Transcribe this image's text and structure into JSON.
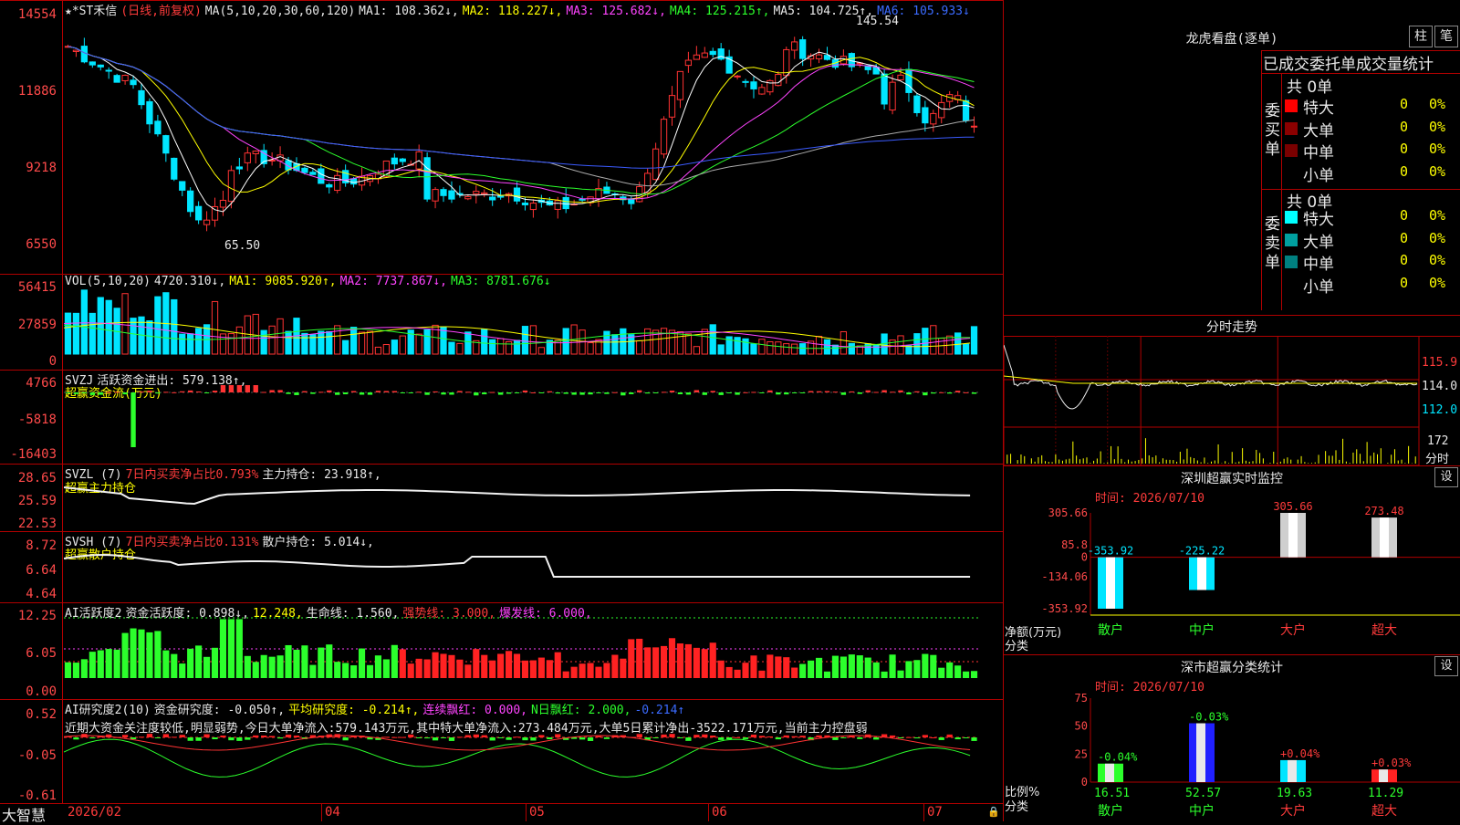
{
  "main": {
    "title": "★*ST禾信",
    "period": "(日线,前复权)",
    "ma_label": "MA(5,10,20,30,60,120)",
    "ma1": "MA1: 108.362↓,",
    "ma2": "MA2: 118.227↓,",
    "ma3": "MA3: 125.682↓,",
    "ma4": "MA4: 125.215↑,",
    "ma5": "MA5: 104.725↑,",
    "ma6": "MA6: 105.933↓",
    "y_ticks": [
      "14554",
      "11886",
      "9218",
      "6550"
    ],
    "high_label": "145.54",
    "low_label": "65.50",
    "price_axis": {
      "max": 14554,
      "min": 6550
    }
  },
  "vol": {
    "title": "VOL(5,10,20)",
    "value": "4720.310↓,",
    "ma1": "MA1: 9085.920↑,",
    "ma2": "MA2: 7737.867↓,",
    "ma3": "MA3: 8781.676↓",
    "y_ticks": [
      "56415",
      "27859",
      "0"
    ]
  },
  "svzj": {
    "title": "SVZJ",
    "label": "活跃资金进出: 579.138↑,",
    "sub": "超赢资金流(万元)",
    "y_ticks": [
      "4766",
      "-5818",
      "-16403"
    ]
  },
  "svzl": {
    "title": "SVZL (7)",
    "label": "7日内买卖净占比0.793%",
    "label2": "主力持仓: 23.918↑,",
    "sub": "超赢主力持仓",
    "y_ticks": [
      "28.65",
      "25.59",
      "22.53"
    ]
  },
  "svsh": {
    "title": "SVSH (7)",
    "label": "7日内买卖净占比0.131%",
    "label2": "散户持仓: 5.014↓,",
    "sub": "超赢散户持仓",
    "y_ticks": [
      "8.72",
      "6.64",
      "4.64"
    ]
  },
  "ai1": {
    "title": "AI活跃度2",
    "a": "资金活跃度: 0.898↓,",
    "b": "12.248,",
    "c": "生命线: 1.560,",
    "d": "强势线: 3.000,",
    "e": "爆发线: 6.000,",
    "y_ticks": [
      "12.25",
      "6.05",
      "0.00"
    ]
  },
  "ai2": {
    "title": "AI研究度2(10)",
    "a": "资金研究度: -0.050↑,",
    "b": "平均研究度: -0.214↑,",
    "c": "连续飘红: 0.000,",
    "d": "N日飘红: 2.000,",
    "e": "-0.214↑",
    "note": "近期大资金关注度较低,明显弱势,今日大单净流入:579.143万元,其中特大单净流入:273.484万元,大单5日累计净出-3522.171万元,当前主力控盘弱",
    "y_ticks": [
      "0.52",
      "-0.05",
      "-0.61"
    ]
  },
  "date_axis": {
    "brand": "大智慧",
    "labels": [
      "2026/02",
      "04",
      "05",
      "06",
      "07"
    ]
  },
  "lhb": {
    "title": "龙虎看盘(逐单)",
    "btn_bar": "柱",
    "btn_pen": "笔",
    "heading": "已成交委托单成交量统计",
    "buy_group": "委买单",
    "sell_group": "委卖单",
    "buy_total": "共 0单",
    "sell_total": "共 0单",
    "rows": [
      {
        "name": "特大",
        "count": "0",
        "pct": "0%"
      },
      {
        "name": "大单",
        "count": "0",
        "pct": "0%"
      },
      {
        "name": "中单",
        "count": "0",
        "pct": "0%"
      },
      {
        "name": "小单",
        "count": "0",
        "pct": "0%"
      }
    ],
    "buy_colors": [
      "#ff0000",
      "#8b0000",
      "#7a0000",
      "#000000"
    ],
    "sell_colors": [
      "#00ffff",
      "#00a0a0",
      "#008080",
      "#000000"
    ]
  },
  "intraday": {
    "title": "分时走势",
    "y_ticks": [
      "115.9",
      "114.0",
      "112.0"
    ],
    "vol_label": "172",
    "vol_unit": "分时"
  },
  "monitor": {
    "title": "深圳超赢实时监控",
    "btn": "设",
    "time": "时间: 2026/07/10",
    "y_ticks": [
      "305.66",
      "85.8",
      "0",
      "-134.06",
      "-353.92"
    ],
    "y_title": "净额(万元)",
    "x_title": "分类",
    "categories": [
      "散户",
      "中户",
      "大户",
      "超大"
    ],
    "values": [
      -353.92,
      -225.22,
      305.66,
      273.48
    ],
    "value_labels": [
      "-353.92",
      "-225.22",
      "305.66",
      "273.48"
    ]
  },
  "classify": {
    "title": "深市超赢分类统计",
    "btn": "设",
    "time": "时间: 2026/07/10",
    "y_ticks": [
      "75",
      "50",
      "25",
      "0"
    ],
    "y_title": "比例%",
    "x_title": "分类",
    "categories": [
      "散户",
      "中户",
      "大户",
      "超大"
    ],
    "values": [
      16.51,
      52.57,
      19.63,
      11.29
    ],
    "value_labels": [
      "16.51",
      "52.57",
      "19.63",
      "11.29"
    ],
    "changes": [
      "-0.04%",
      "-0.03%",
      "+0.04%",
      "+0.03%"
    ]
  }
}
